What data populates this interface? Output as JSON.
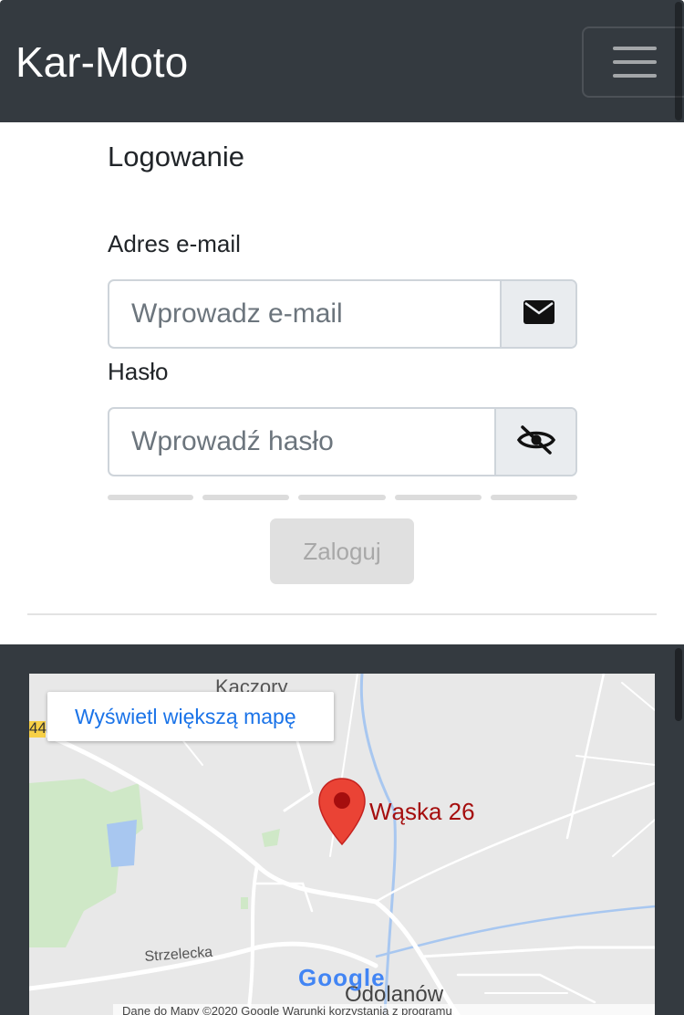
{
  "navbar": {
    "brand": "Kar-Moto"
  },
  "login": {
    "title": "Logowanie",
    "email_label": "Adres e-mail",
    "email_placeholder": "Wprowadz e-mail",
    "email_icon": "envelope-icon",
    "password_label": "Hasło",
    "password_placeholder": "Wprowadź hasło",
    "password_icon": "eye-slash-icon",
    "password_strength_segments": 5,
    "submit_label": "Zaloguj"
  },
  "map": {
    "view_larger_label": "Wyświetl większą mapę",
    "marker_label": "Wąska 26",
    "places": [
      "Kaczory",
      "Strzelecka",
      "Odolanów"
    ],
    "route_shield": "44",
    "logo": "Google",
    "attribution": "Dane do Mapy ©2020 Google   Warunki korzystania z programu"
  },
  "colors": {
    "navbar_bg": "#343a40",
    "marker": "#ea4335",
    "link": "#1a73e8"
  }
}
